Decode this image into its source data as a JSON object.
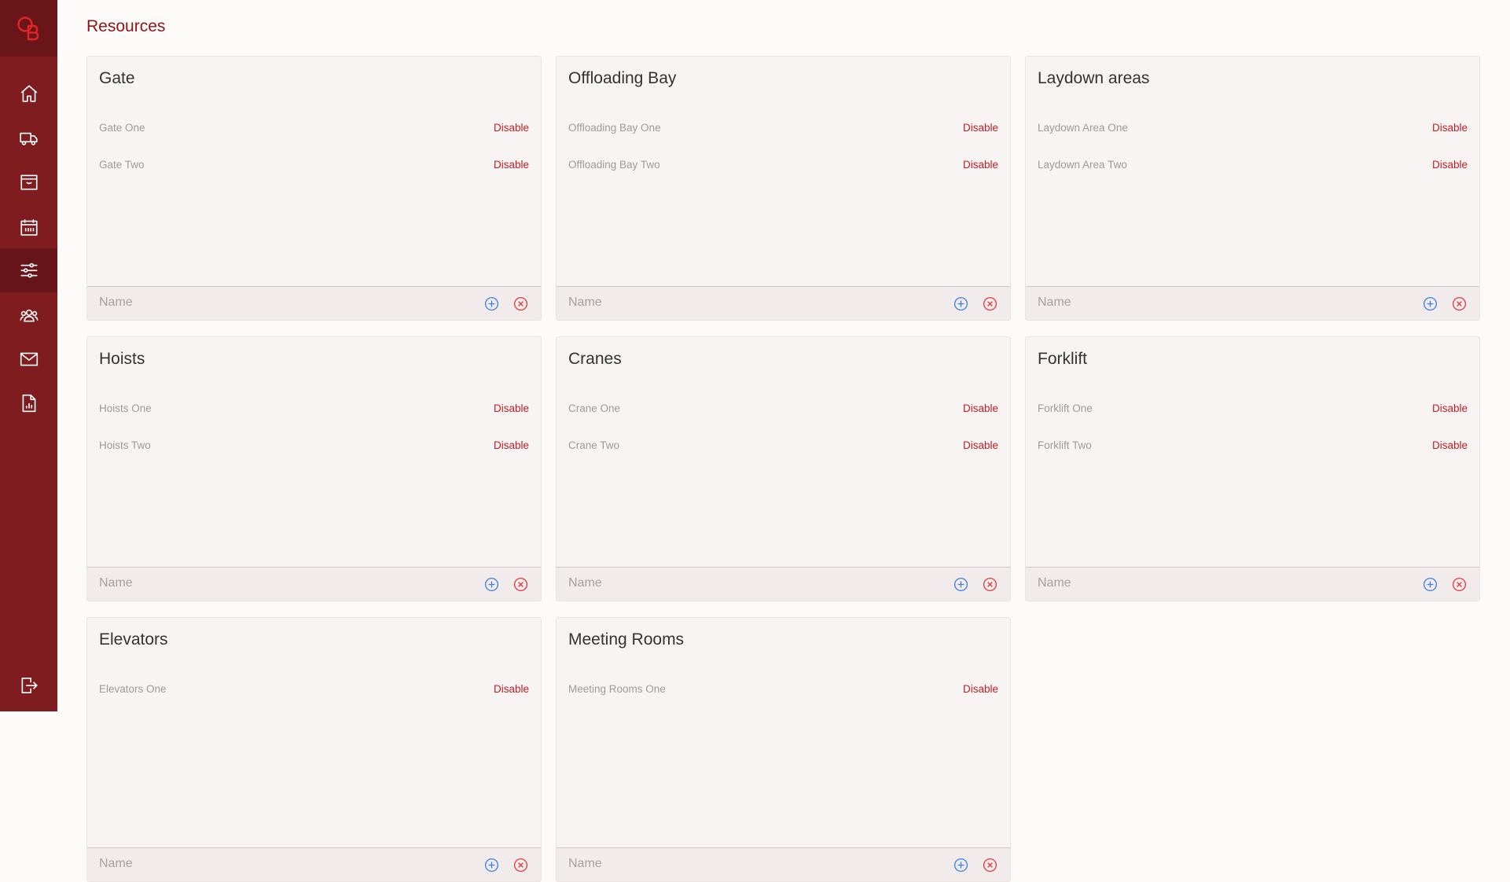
{
  "app": {
    "logo_label": "QB",
    "colors": {
      "sidebar": "#7e1c1f",
      "accent": "#c21d23",
      "title": "#8e1417",
      "add_icon": "#3d7fe0",
      "cancel_icon": "#e03a3f"
    }
  },
  "sidebar": {
    "items": [
      {
        "icon": "home-icon",
        "active": false
      },
      {
        "icon": "truck-icon",
        "active": false
      },
      {
        "icon": "archive-box-icon",
        "active": false
      },
      {
        "icon": "calendar-icon",
        "active": false
      },
      {
        "icon": "sliders-icon",
        "active": true
      },
      {
        "icon": "people-icon",
        "active": false
      },
      {
        "icon": "mail-icon",
        "active": false
      },
      {
        "icon": "report-icon",
        "active": false
      }
    ],
    "logout_icon": "logout-icon"
  },
  "page": {
    "title": "Resources"
  },
  "resources": [
    {
      "title": "Gate",
      "items": [
        {
          "name": "Gate One",
          "action": "Disable"
        },
        {
          "name": "Gate Two",
          "action": "Disable"
        }
      ],
      "placeholder": "Name"
    },
    {
      "title": "Offloading Bay",
      "items": [
        {
          "name": "Offloading Bay One",
          "action": "Disable"
        },
        {
          "name": "Offloading Bay Two",
          "action": "Disable"
        }
      ],
      "placeholder": "Name"
    },
    {
      "title": "Laydown areas",
      "items": [
        {
          "name": "Laydown Area One",
          "action": "Disable"
        },
        {
          "name": "Laydown Area Two",
          "action": "Disable"
        }
      ],
      "placeholder": "Name"
    },
    {
      "title": "Hoists",
      "items": [
        {
          "name": "Hoists One",
          "action": "Disable"
        },
        {
          "name": "Hoists Two",
          "action": "Disable"
        }
      ],
      "placeholder": "Name"
    },
    {
      "title": "Cranes",
      "items": [
        {
          "name": "Crane One",
          "action": "Disable"
        },
        {
          "name": "Crane Two",
          "action": "Disable"
        }
      ],
      "placeholder": "Name"
    },
    {
      "title": "Forklift",
      "items": [
        {
          "name": "Forklift One",
          "action": "Disable"
        },
        {
          "name": "Forklift Two",
          "action": "Disable"
        }
      ],
      "placeholder": "Name"
    },
    {
      "title": "Elevators",
      "items": [
        {
          "name": "Elevators One",
          "action": "Disable"
        }
      ],
      "placeholder": "Name"
    },
    {
      "title": "Meeting Rooms",
      "items": [
        {
          "name": "Meeting Rooms One",
          "action": "Disable"
        }
      ],
      "placeholder": "Name"
    }
  ]
}
